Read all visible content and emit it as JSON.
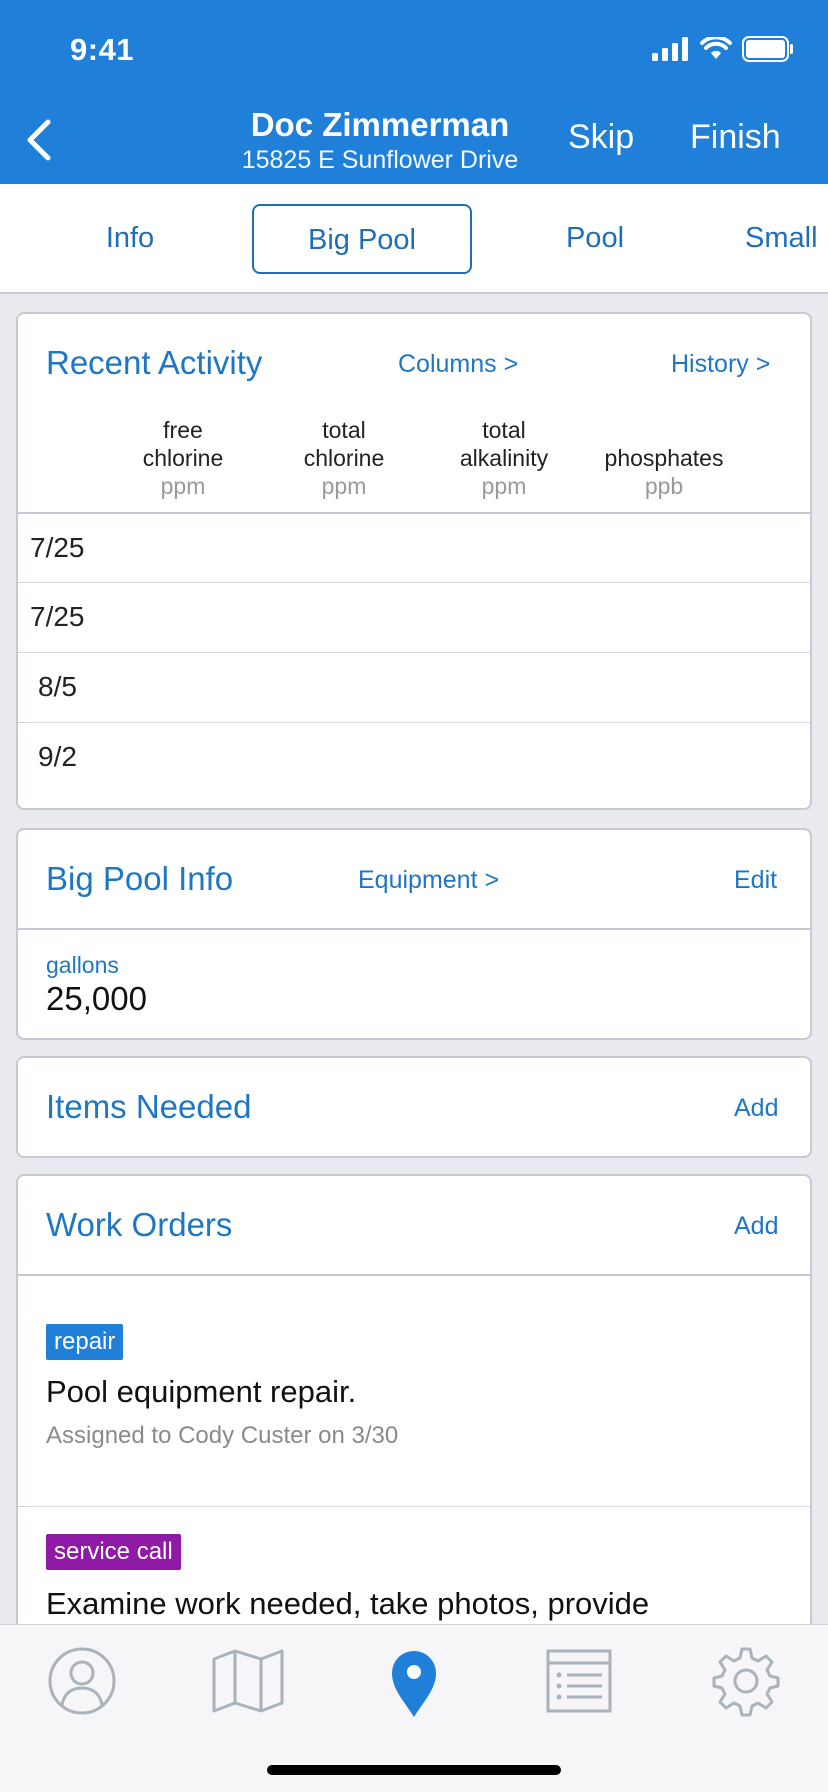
{
  "status_bar": {
    "time": "9:41"
  },
  "header": {
    "title": "Doc Zimmerman",
    "subtitle": "15825 E Sunflower Drive",
    "skip_label": "Skip",
    "finish_label": "Finish"
  },
  "tabs": [
    {
      "label": "Info"
    },
    {
      "label": "Big Pool"
    },
    {
      "label": "Pool"
    },
    {
      "label": "Small"
    }
  ],
  "recent_activity": {
    "title": "Recent Activity",
    "columns_link": "Columns >",
    "history_link": "History >",
    "columns": [
      {
        "line1": "free",
        "line2": "chlorine",
        "unit": "ppm"
      },
      {
        "line1": "total",
        "line2": "chlorine",
        "unit": "ppm"
      },
      {
        "line1": "total",
        "line2": "alkalinity",
        "unit": "ppm"
      },
      {
        "line1": "",
        "line2": "phosphates",
        "unit": "ppb"
      }
    ],
    "rows": [
      {
        "date": "7/25"
      },
      {
        "date": "7/25"
      },
      {
        "date": "8/5"
      },
      {
        "date": "9/2"
      }
    ]
  },
  "pool_info": {
    "title": "Big Pool Info",
    "equipment_link": "Equipment >",
    "edit_label": "Edit",
    "gallons_label": "gallons",
    "gallons_value": "25,000"
  },
  "items_needed": {
    "title": "Items Needed",
    "add_label": "Add"
  },
  "work_orders": {
    "title": "Work Orders",
    "add_label": "Add",
    "items": [
      {
        "tag": "repair",
        "tag_color": "#1f7fd9",
        "title": "Pool equipment repair.",
        "assigned": "Assigned to Cody Custer on 3/30"
      },
      {
        "tag": "service call",
        "tag_color": "#8e1aa6",
        "title": "Examine work needed, take photos, provide",
        "assigned": ""
      }
    ]
  },
  "tabbar": {
    "items": [
      {
        "icon": "profile-icon"
      },
      {
        "icon": "map-icon"
      },
      {
        "icon": "location-pin-icon"
      },
      {
        "icon": "list-icon"
      },
      {
        "icon": "gear-icon"
      }
    ],
    "active_color": "#1f7fd9",
    "inactive_color": "#a9b3bc"
  }
}
